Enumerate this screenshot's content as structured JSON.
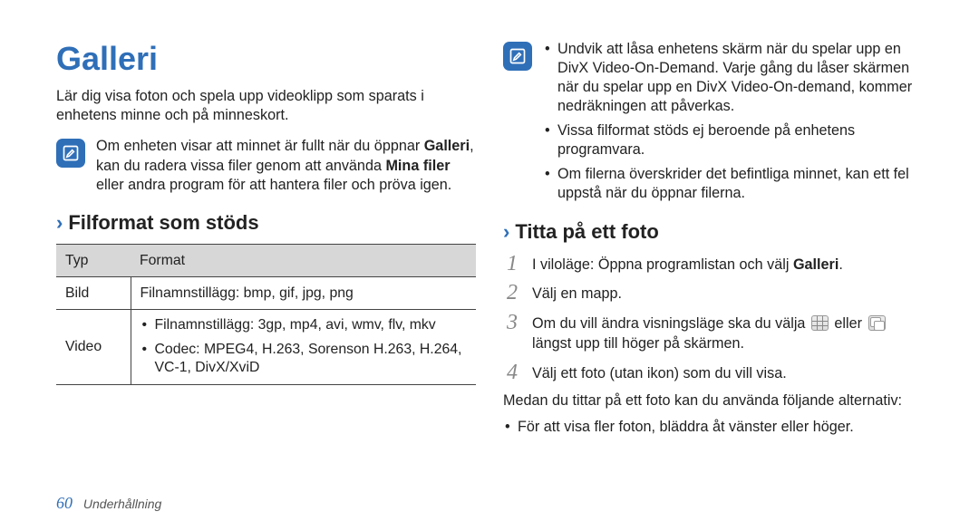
{
  "left": {
    "title": "Galleri",
    "intro": "Lär dig visa foton och spela upp videoklipp som sparats i enhetens minne och på minneskort.",
    "note": {
      "line1_a": "Om enheten visar att minnet är fullt när du öppnar ",
      "line1_bold": "Galleri",
      "line1_b": ", kan du radera vissa filer genom att använda ",
      "line2_bold": "Mina filer",
      "line2_b": " eller andra program för att hantera filer och pröva igen."
    },
    "section": "Filformat som stöds",
    "table": {
      "headers": {
        "type": "Typ",
        "format": "Format"
      },
      "rows": {
        "r1": {
          "type": "Bild",
          "format": "Filnamnstillägg: bmp, gif, jpg, png"
        },
        "r2": {
          "type": "Video",
          "b1": "Filnamnstillägg: 3gp, mp4, avi, wmv, flv, mkv",
          "b2": "Codec: MPEG4, H.263, Sorenson H.263, H.264, VC-1, DivX/XviD"
        }
      }
    }
  },
  "right": {
    "note_bullets": {
      "b1": "Undvik att låsa enhetens skärm när du spelar upp en DivX Video-On-Demand. Varje gång du låser skärmen när du spelar upp en DivX Video-On-demand, kommer nedräkningen att påverkas.",
      "b2": "Vissa filformat stöds ej beroende på enhetens programvara.",
      "b3": "Om filerna överskrider det befintliga minnet, kan ett fel uppstå när du öppnar filerna."
    },
    "section": "Titta på ett foto",
    "steps": {
      "s1_a": "I viloläge: Öppna programlistan och välj ",
      "s1_bold": "Galleri",
      "s1_b": ".",
      "s2": "Välj en mapp.",
      "s3_a": "Om du vill ändra visningsläge ska du välja ",
      "s3_mid": " eller ",
      "s3_b": " längst upp till höger på skärmen.",
      "s4": "Välj ett foto (utan ikon) som du vill visa."
    },
    "after": "Medan du tittar på ett foto kan du använda följande alternativ:",
    "body_bullets": {
      "b1": "För att visa fler foton, bläddra åt vänster eller höger."
    }
  },
  "footer": {
    "page": "60",
    "section": "Underhållning"
  },
  "ui": {
    "chevron": "›"
  },
  "nums": {
    "n1": "1",
    "n2": "2",
    "n3": "3",
    "n4": "4"
  }
}
